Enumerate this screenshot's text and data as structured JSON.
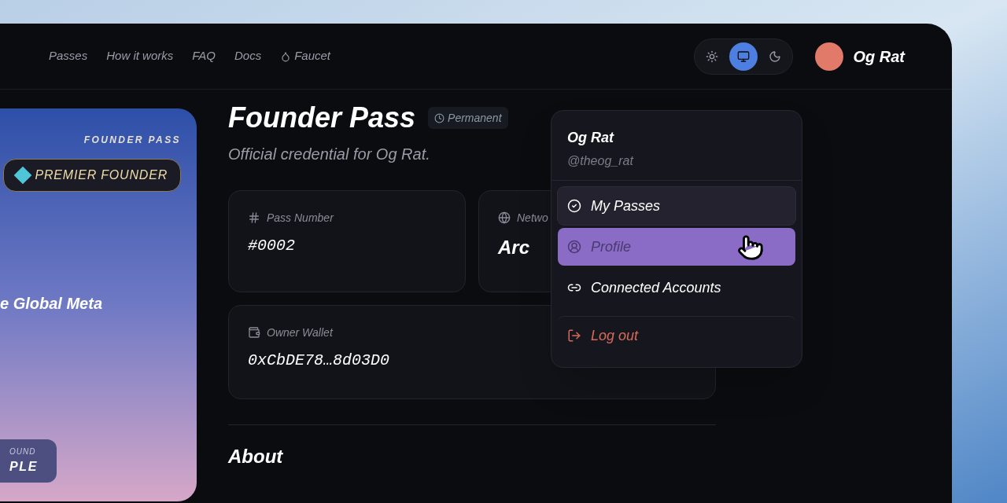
{
  "nav": {
    "links": [
      {
        "label": "Passes",
        "kind": "text"
      },
      {
        "label": "How it works",
        "kind": "text"
      },
      {
        "label": "FAQ",
        "kind": "text"
      },
      {
        "label": "Docs",
        "kind": "text"
      },
      {
        "label": "Faucet",
        "kind": "drop"
      }
    ]
  },
  "theme_toggle": [
    {
      "kind": "light",
      "selected": false
    },
    {
      "kind": "system",
      "selected": true
    },
    {
      "kind": "dark",
      "selected": false
    }
  ],
  "user": {
    "name": "Og Rat"
  },
  "pass_card": {
    "eyebrow": "FOUNDER PASS",
    "badge": "PREMIER FOUNDER",
    "headline": "e Global Meta",
    "footer_label": "OUND",
    "footer_value": "PLE"
  },
  "header": {
    "title": "Founder Pass",
    "badge": "Permanent",
    "subtitle": "Official credential for Og Rat."
  },
  "cards": [
    {
      "kind": "hash",
      "label": "Pass Number",
      "value": "#0002",
      "mono": true
    },
    {
      "kind": "globe",
      "label": "Netwo",
      "value": "Arc",
      "mono": false
    },
    {
      "kind": "wallet",
      "label": "Owner Wallet",
      "value": "0xCbDE78…8d03D0",
      "mono": true
    }
  ],
  "about": {
    "title": "About"
  },
  "menu": {
    "name": "Og Rat",
    "handle": "@theog_rat",
    "items": [
      {
        "kind": "check",
        "label": "My Passes",
        "selected": false,
        "hovered": true,
        "danger": false
      },
      {
        "kind": "user",
        "label": "Profile",
        "selected": true,
        "hovered": false,
        "danger": false
      },
      {
        "kind": "link",
        "label": "Connected Accounts",
        "selected": false,
        "hovered": false,
        "danger": false
      },
      {
        "kind": "logout",
        "label": "Log out",
        "selected": false,
        "hovered": false,
        "danger": true
      }
    ]
  }
}
